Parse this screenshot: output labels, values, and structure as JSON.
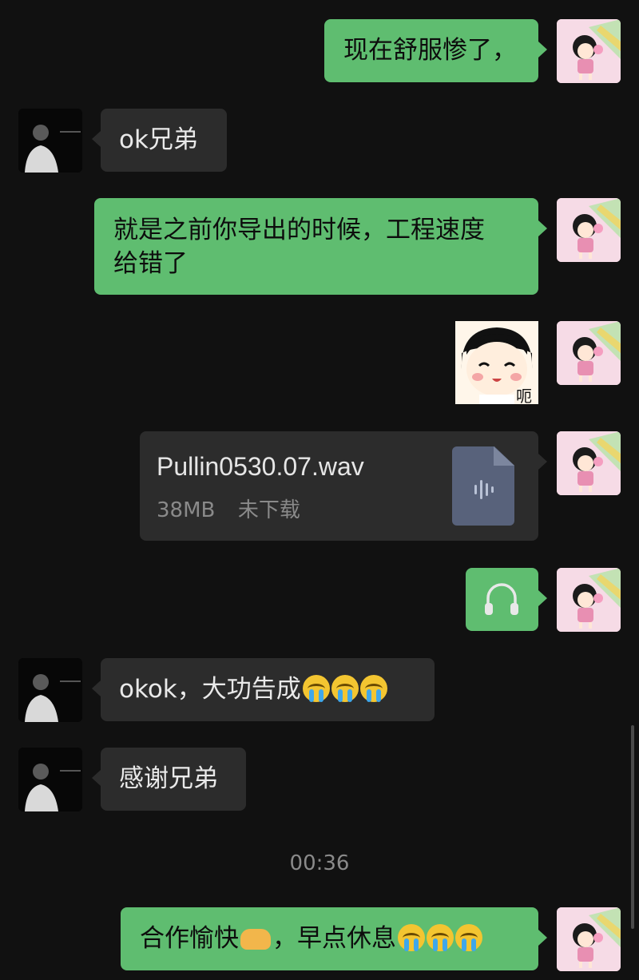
{
  "messages": {
    "m1_text": "现在舒服惨了，",
    "m2_text": "ok兄弟",
    "m3_line1": "就是之前你导出的时候，工程速度",
    "m3_line2": "给错了",
    "m5_file_name": "Pullin0530.07.wav",
    "m5_file_size": "38MB",
    "m5_file_status": "未下载",
    "m7_text": "okok，大功告成",
    "m8_text": "感谢兄弟",
    "m9_text_a": "合作愉快",
    "m9_text_b": "，早点休息"
  },
  "timestamp": "00:36",
  "sticker_text": "呃",
  "icons": {
    "sticker": "chibi-girl-sticker-icon",
    "file": "audio-file-icon",
    "headphones": "headphones-icon",
    "emoji_cry": "loudly-crying-face-emoji",
    "emoji_handshake": "handshake-emoji"
  },
  "colors": {
    "background": "#111111",
    "outgoing_bubble": "#5fbd70",
    "incoming_bubble": "#2c2c2c",
    "file_icon": "#58627b"
  }
}
